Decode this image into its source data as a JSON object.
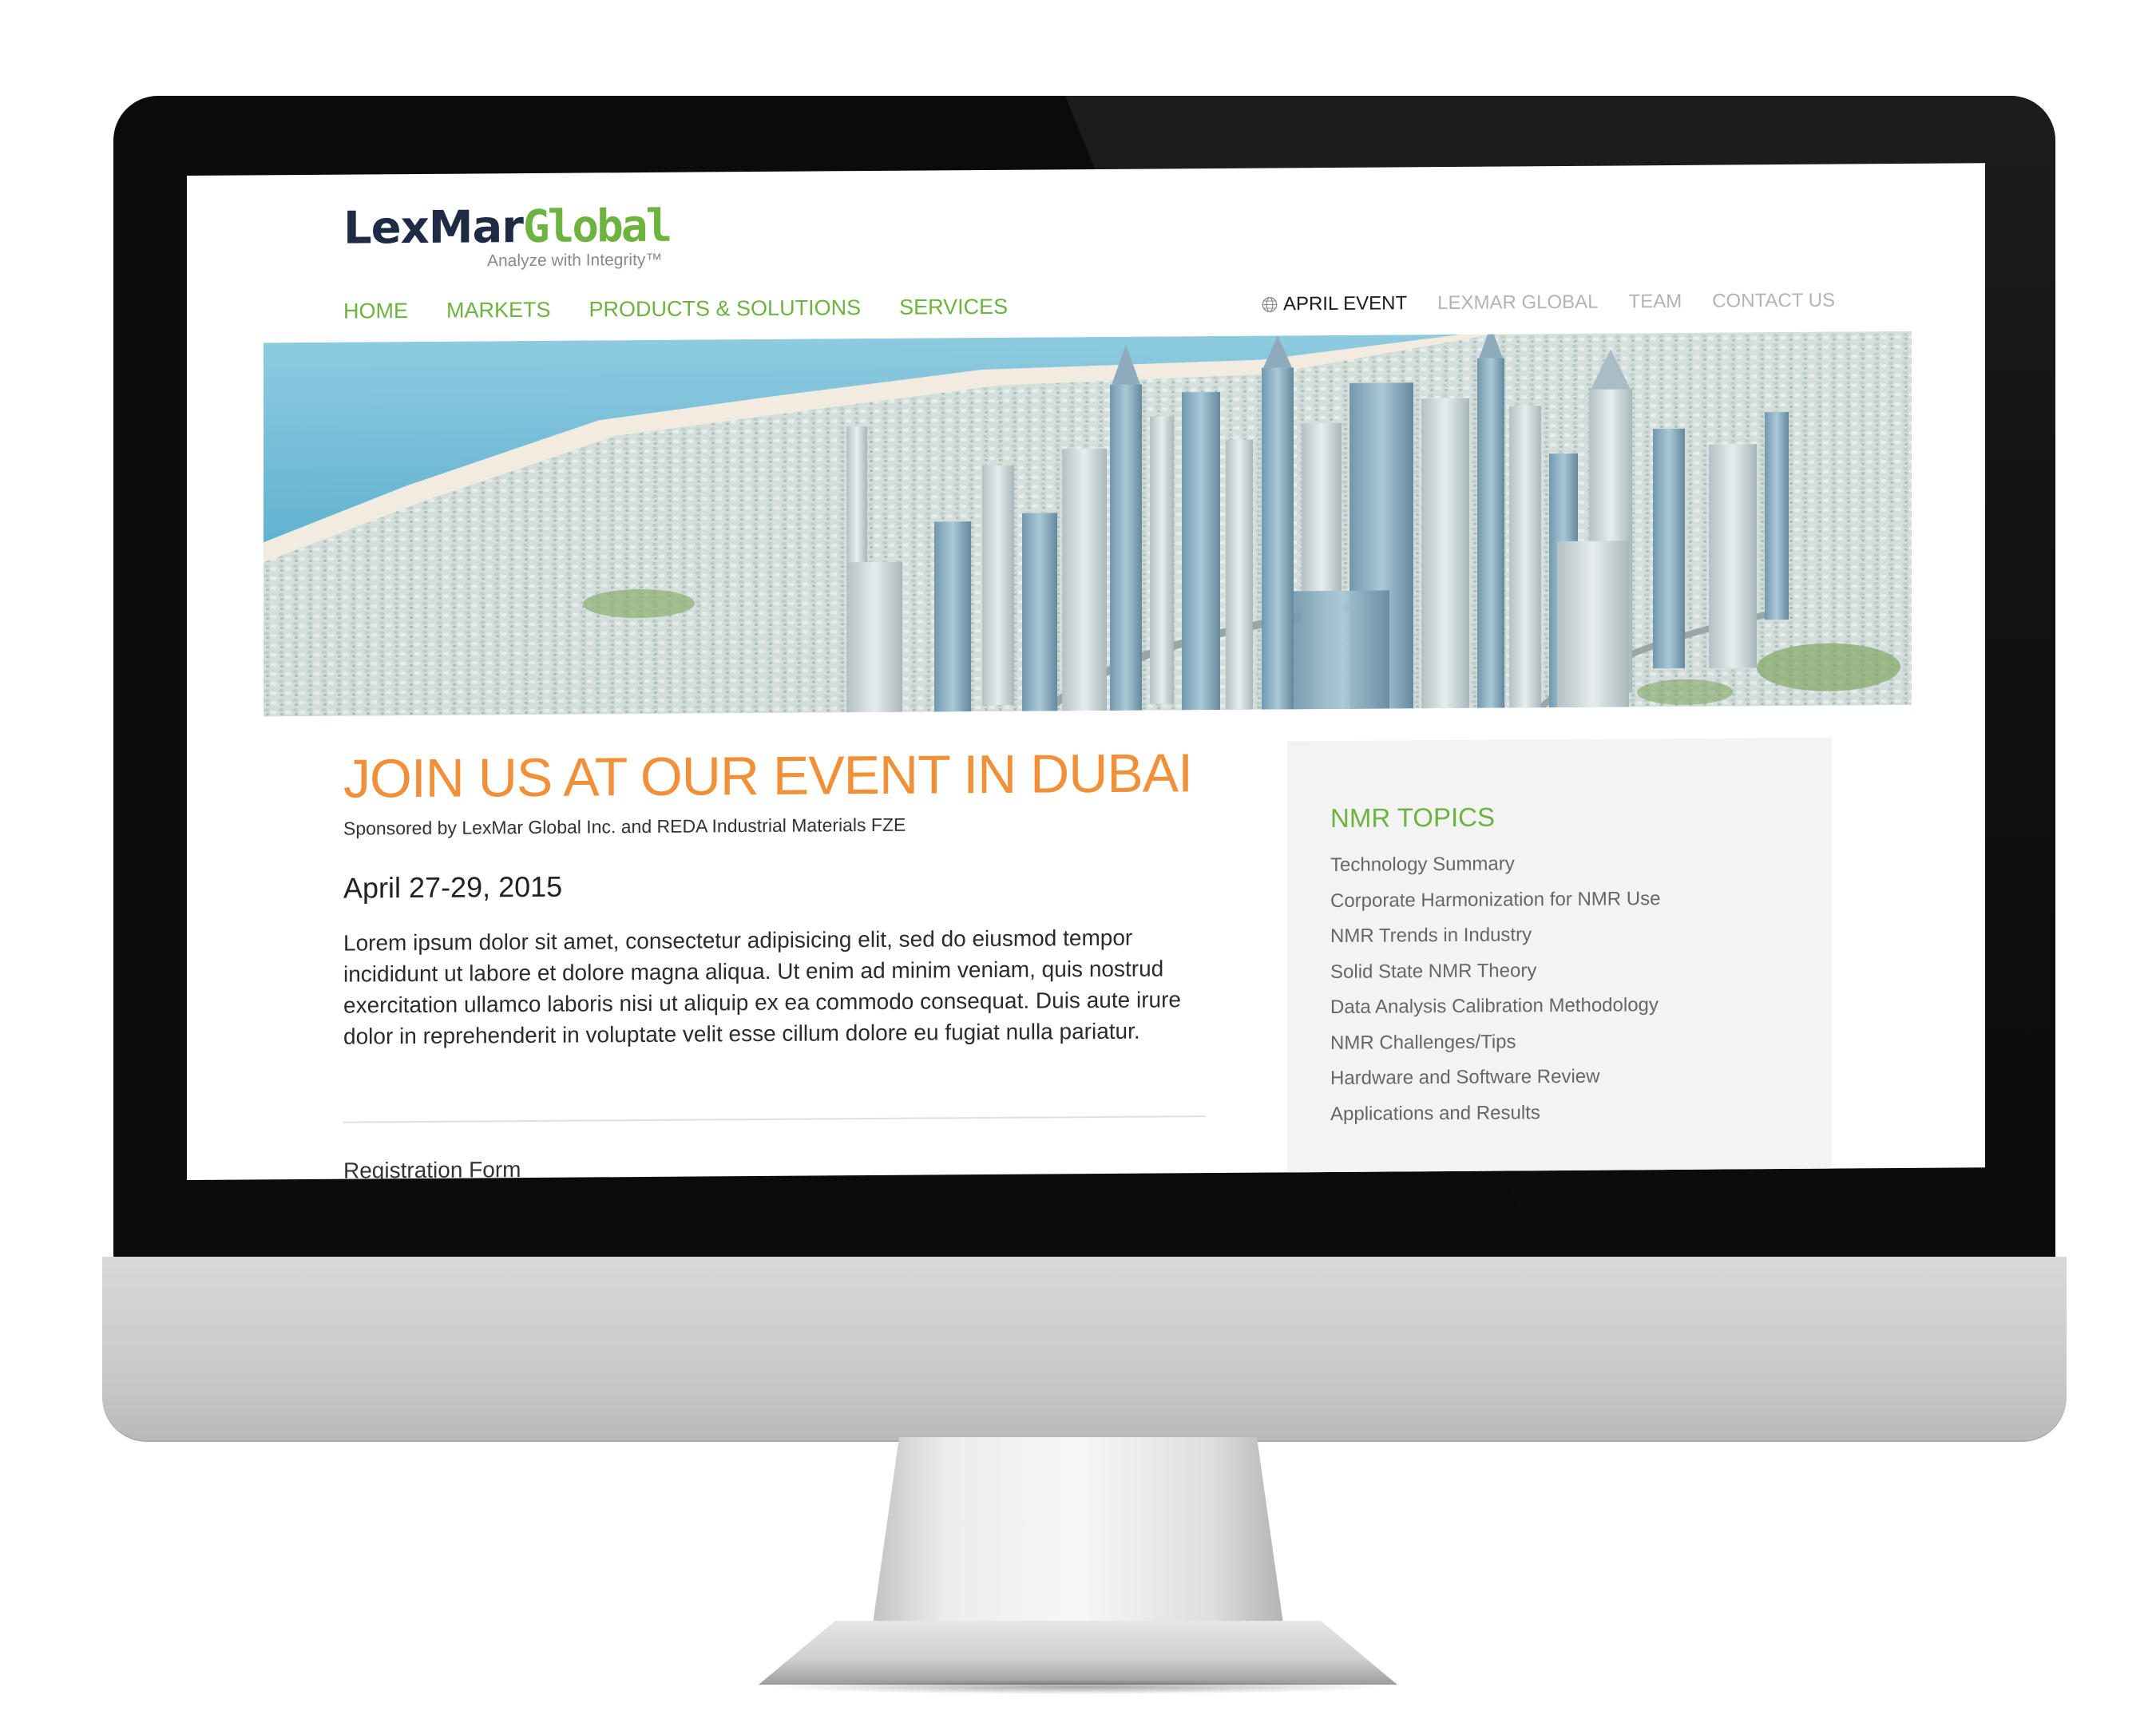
{
  "site": {
    "logo": {
      "part1": "LexMar",
      "part2": "Global",
      "tagline": "Analyze with Integrity™"
    },
    "nav_main": [
      "HOME",
      "MARKETS",
      "PRODUCTS & SOLUTIONS",
      "SERVICES"
    ],
    "nav_util": {
      "active": "APRIL EVENT",
      "items": [
        "LEXMAR GLOBAL",
        "TEAM",
        "CONTACT US"
      ]
    }
  },
  "event": {
    "title": "JOIN US AT OUR EVENT IN DUBAI",
    "sponsor": "Sponsored by LexMar Global Inc. and REDA Industrial Materials FZE",
    "date": "April 27-29, 2015",
    "body": "Lorem ipsum dolor sit amet, consectetur adipisicing elit, sed do eiusmod tempor incididunt ut labore et dolore magna aliqua. Ut enim ad minim veniam, quis nostrud exercitation ullamco laboris nisi ut aliquip ex ea commodo consequat. Duis aute irure dolor in reprehenderit in voluptate velit esse cillum dolore eu fugiat nulla pariatur.",
    "registration_label": "Registration Form"
  },
  "sidebar": {
    "title": "NMR TOPICS",
    "topics": [
      "Technology Summary",
      "Corporate Harmonization for NMR Use",
      "NMR Trends in Industry",
      "Solid State NMR Theory",
      "Data Analysis Calibration Methodology",
      "NMR Challenges/Tips",
      "Hardware and Software Review",
      "Applications and Results"
    ]
  },
  "colors": {
    "brand_green": "#6cb33f",
    "brand_navy": "#1f2a44",
    "accent_orange": "#f0913a"
  },
  "icons": {
    "globe": "globe-icon"
  }
}
